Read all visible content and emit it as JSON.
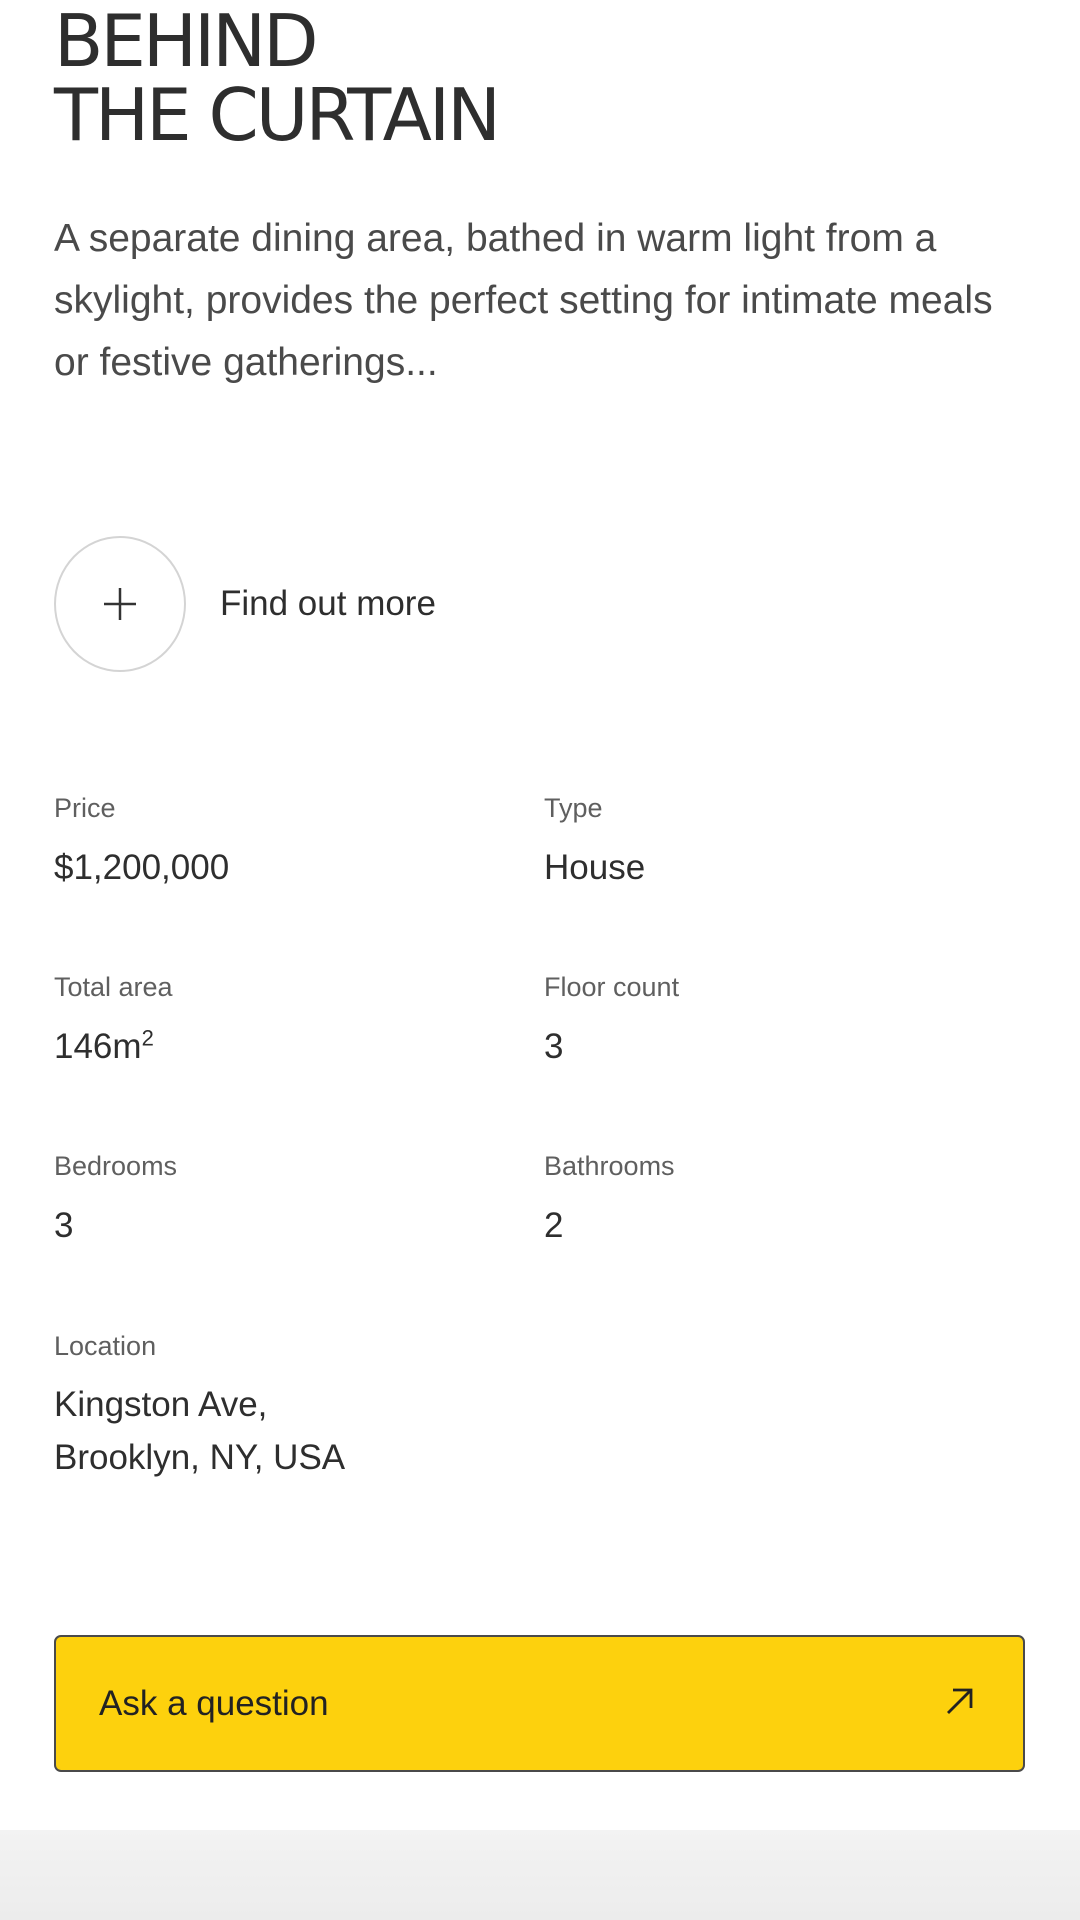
{
  "hero": {
    "title_line1": "BEHIND",
    "title_line2": "THE CURTAIN",
    "description": "A separate dining area, bathed in warm light from a skylight, provides the perfect setting for intimate meals or festive gatherings..."
  },
  "find_more": {
    "icon": "plus-icon",
    "label": "Find out more"
  },
  "specs": {
    "price": {
      "label": "Price",
      "value": "$1,200,000"
    },
    "type": {
      "label": "Type",
      "value": "House"
    },
    "total_area": {
      "label": "Total area",
      "value": "146m",
      "unit_sup": "2"
    },
    "floor_count": {
      "label": "Floor count",
      "value": "3"
    },
    "bedrooms": {
      "label": "Bedrooms",
      "value": "3"
    },
    "bathrooms": {
      "label": "Bathrooms",
      "value": "2"
    },
    "location": {
      "label": "Location",
      "value_line1": "Kingston Ave,",
      "value_line2": "Brooklyn, NY, USA"
    }
  },
  "cta": {
    "label": "Ask a question",
    "icon": "arrow-up-right-icon",
    "color": "#fdd10d"
  }
}
